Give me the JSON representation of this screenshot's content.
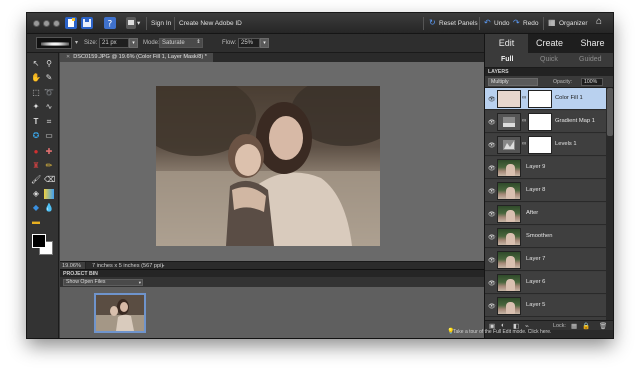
{
  "topbar": {
    "sign_in": "Sign In",
    "create_id": "Create New Adobe ID",
    "reset_panels": "Reset Panels",
    "undo": "Undo",
    "redo": "Redo",
    "organizer": "Organizer"
  },
  "options": {
    "size_label": "Size:",
    "size_value": "21 px",
    "mode_label": "Mode:",
    "mode_value": "Saturate",
    "flow_label": "Flow:",
    "flow_value": "25%"
  },
  "document": {
    "tab_title": "DSC0159.JPG @ 19.6% (Color Fill 1, Layer Mask/8) *",
    "zoom": "19.06%",
    "doc_size": "7 inches x 5 inches (567 ppi)"
  },
  "project_bin": {
    "title": "PROJECT BIN",
    "filter": "Show Open Files"
  },
  "modes": {
    "edit": "Edit",
    "create": "Create",
    "share": "Share"
  },
  "edit_tabs": {
    "full": "Full",
    "quick": "Quick",
    "guided": "Guided"
  },
  "layers_panel": {
    "title": "LAYERS",
    "blend_mode": "Multiply",
    "opacity_label": "Opacity:",
    "opacity_value": "100%",
    "lock_label": "Lock:",
    "layers": [
      {
        "name": "Color Fill 1",
        "kind": "adjustment",
        "selected": true
      },
      {
        "name": "Gradient Map 1",
        "kind": "adjustment",
        "selected": false
      },
      {
        "name": "Levels 1",
        "kind": "adjustment",
        "selected": false
      },
      {
        "name": "Layer 9",
        "kind": "photo",
        "selected": false
      },
      {
        "name": "Layer 8",
        "kind": "photo",
        "selected": false
      },
      {
        "name": "After",
        "kind": "photo",
        "selected": false
      },
      {
        "name": "Smoothen",
        "kind": "photo",
        "selected": false
      },
      {
        "name": "Layer 7",
        "kind": "photo",
        "selected": false
      },
      {
        "name": "Layer 6",
        "kind": "photo",
        "selected": false
      },
      {
        "name": "Layer 5",
        "kind": "photo",
        "selected": false
      }
    ]
  },
  "hint": {
    "text": "Take a tour of the Full Edit mode. Click here."
  },
  "colors": {
    "selection": "#b9d1ef",
    "panel": "#2a2a2a",
    "canvas": "#6a6a6a",
    "accent_blue": "#2f6fd6"
  },
  "icons": [
    "home-icon",
    "organizer-icon",
    "undo-icon",
    "redo-icon",
    "reset-icon",
    "eye-icon",
    "link-icon",
    "lock-icon",
    "trash-icon"
  ]
}
